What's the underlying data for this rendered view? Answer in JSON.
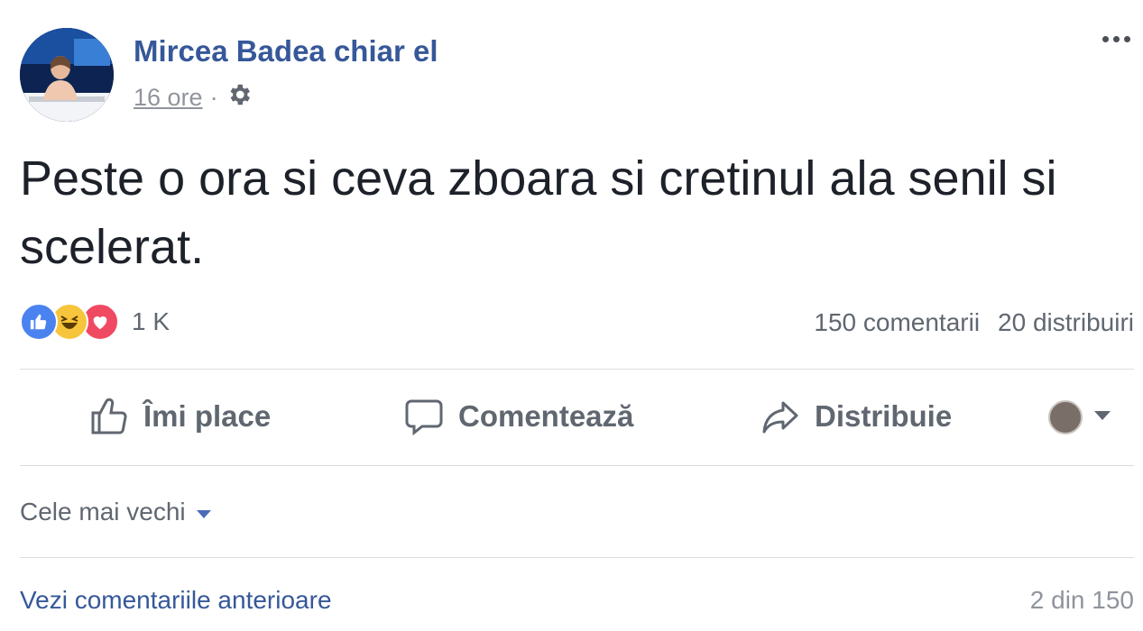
{
  "post": {
    "author": "Mircea Badea chiar el",
    "timestamp": "16 ore",
    "separator": "·",
    "privacy_icon": "gear-icon",
    "message": "Peste o ora si ceva zboara si cretinul ala senil si scelerat.",
    "reactions": {
      "types": [
        "like",
        "haha",
        "love"
      ],
      "count": "1 K"
    },
    "comments_count": "150 comentarii",
    "shares_count": "20 distribuiri"
  },
  "actions": {
    "like_label": "Îmi place",
    "comment_label": "Comentează",
    "share_label": "Distribuie"
  },
  "comments": {
    "sort_label": "Cele mai vechi",
    "view_previous": "Vezi comentariile anterioare",
    "pager": "2 din 150"
  },
  "colors": {
    "link_blue": "#365899",
    "like_blue": "#4a83f0",
    "love_red": "#ef4a62",
    "haha_yellow": "#f7c53b",
    "muted_text": "#606770"
  }
}
